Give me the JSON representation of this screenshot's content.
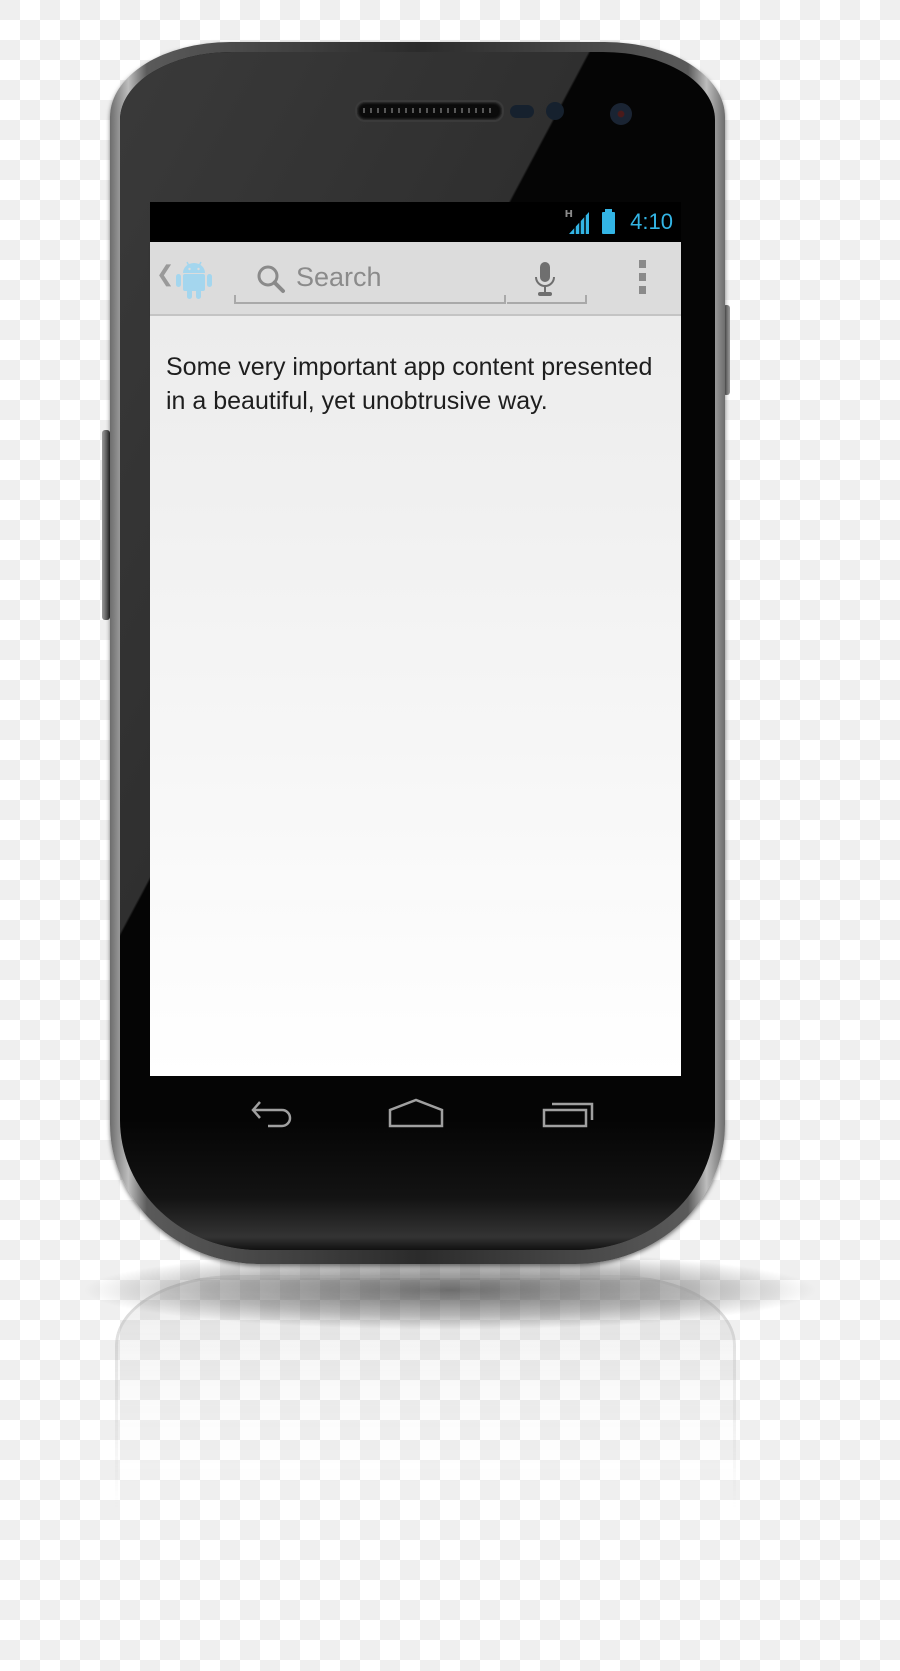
{
  "device": {
    "type": "android-phone-mockup",
    "background": "transparent-checkerboard"
  },
  "status_bar": {
    "network_type": "H",
    "signal_icon": "signal-strength-icon",
    "battery_icon": "battery-full-icon",
    "time": "4:10",
    "accent_color": "#33b5e5"
  },
  "action_bar": {
    "up_icon": "chevron-left-icon",
    "app_icon": "android-robot-icon",
    "search": {
      "icon": "search-icon",
      "placeholder": "Search",
      "value": ""
    },
    "voice_icon": "microphone-icon",
    "overflow_icon": "more-vertical-icon"
  },
  "content": {
    "text": "Some very important app content presented in a beautiful, yet unobtrusive way."
  },
  "nav_bar": {
    "buttons": [
      {
        "name": "back",
        "icon": "back-arrow-icon"
      },
      {
        "name": "home",
        "icon": "home-icon"
      },
      {
        "name": "recents",
        "icon": "recent-apps-icon"
      }
    ]
  }
}
